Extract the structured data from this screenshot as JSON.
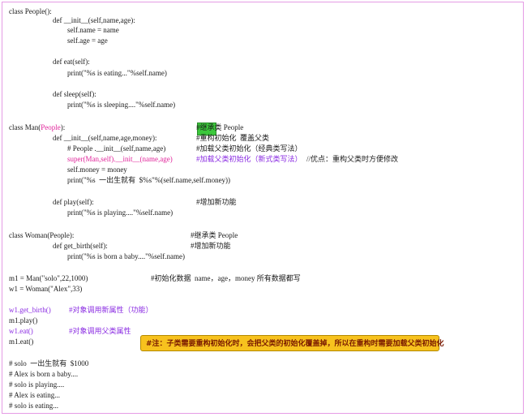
{
  "code": {
    "l01": "class People():",
    "l02": "def __init__(self,name,age):",
    "l03": "self.name = name",
    "l04": "self.age = age",
    "l05": "def eat(self):",
    "l06": "print(\"%s is eating...\"%self.name)",
    "l07": "def sleep(self):",
    "l08": "print(\"%s is sleeping....\"%self.name)",
    "l09a": "class Man(",
    "l09b": "People",
    "l09c": "):",
    "l09d": "#继承类 People",
    "l10a": "def __init__(self,name,age,money):",
    "l10b": "#重构初始化  覆盖父类",
    "l11a": "# People .__init__(self,name,age)",
    "l11b": "#加载父类初始化（经典类写法）",
    "l12a": "super(Man,self).__init__(name,age)",
    "l12b": "#加载父类初始化（新式类写法）",
    "l12c": "//优点：重构父类时方便修改",
    "l13": "self.money = money",
    "l14": "print(\"%s  一出生就有  $%s\"%(self.name,self.money))",
    "l15a": "def play(self):",
    "l15b": "#增加新功能",
    "l16": "print(\"%s is playing....\"%self.name)",
    "l17a": "class Woman(People):",
    "l17b": "#继承类 People",
    "l18a": "def get_birth(self):",
    "l18b": "#增加新功能",
    "l19": "print(\"%s is born a baby....\"%self.name)",
    "l20a": "m1 = Man(\"solo\",22,1000)",
    "l20b": "#初始化数据  name，age，money 所有数据都写",
    "l21": "w1 = Woman(\"Alex\",33)",
    "l22a": "w1.get_birth()",
    "l22b": "#对象调用新属性（功能）",
    "l23": "m1.play()",
    "l24a": "w1.eat()",
    "l24b": "#对象调用父类属性",
    "l25": "m1.eat()",
    "o1": "# solo  一出生就有  $1000",
    "o2": "# Alex is born a baby....",
    "o3": "# solo is playing....",
    "o4": "# Alex is eating...",
    "o5": "# solo is eating..."
  },
  "note": "#注：子类需要重构初始化时，会把父类的初始化覆盖掉，所以在重构时需要加载父类初始化",
  "colors": {
    "border": "#e59be5",
    "pink": "#e0249a",
    "purple": "#8a2be2",
    "note_bg": "#f7c21e",
    "highlight": "#3cc83c"
  }
}
